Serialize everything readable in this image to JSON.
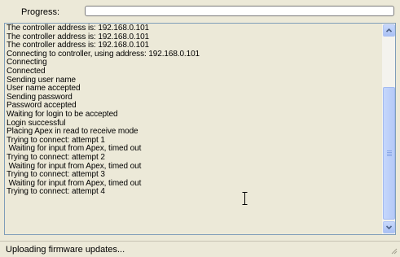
{
  "progress": {
    "label": "Progress:",
    "value": 0,
    "fill_color": "#3cb44a"
  },
  "log": {
    "lines": [
      "The controller address is: 192.168.0.101",
      "The controller address is: 192.168.0.101",
      "The controller address is: 192.168.0.101",
      "Connecting to controller, using address: 192.168.0.101",
      "Connecting",
      "Connected",
      "Sending user name",
      "User name accepted",
      "Sending password",
      "Password accepted",
      "Waiting for login to be accepted",
      "Login successful",
      "Placing Apex in read to receive mode",
      "Trying to connect: attempt 1",
      " Waiting for input from Apex, timed out",
      "Trying to connect: attempt 2",
      " Waiting for input from Apex, timed out",
      "Trying to connect: attempt 3",
      " Waiting for input from Apex, timed out",
      "Trying to connect: attempt 4"
    ]
  },
  "scrollbar": {
    "up_icon": "arrow-up-icon",
    "down_icon": "arrow-down-icon"
  },
  "cursor": {
    "icon": "text-cursor-icon"
  },
  "status": {
    "text": "Uploading firmware updates..."
  }
}
